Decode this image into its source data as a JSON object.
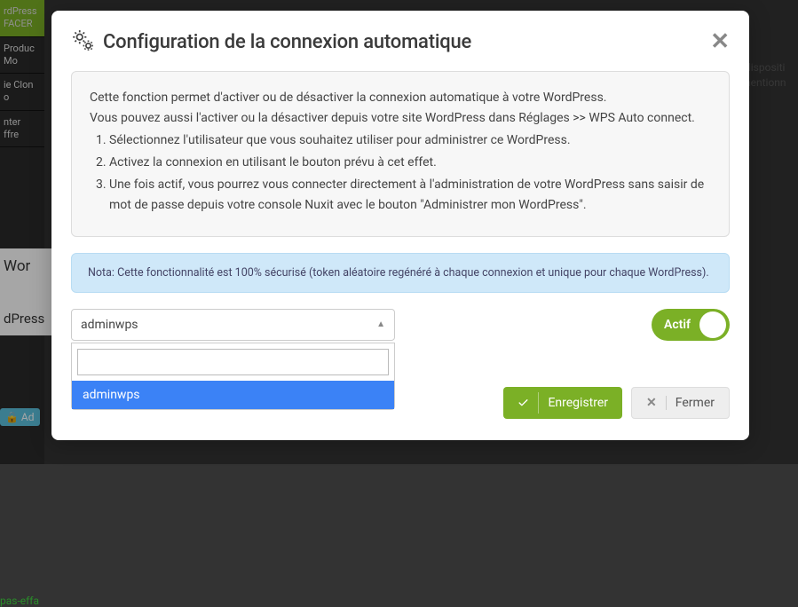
{
  "background": {
    "sidebar_items": [
      "rdPress",
      "FACER",
      "Produc",
      "Mo",
      "ie Clon",
      "o",
      "nter",
      "ffre"
    ],
    "content_head": "Wor",
    "content_sub": "dPress",
    "pas_effa": "pas-effa",
    "admin_btn": "Ad",
    "right_text1": "dispositi",
    "right_text2": "nentionn"
  },
  "dialog": {
    "title": "Configuration de la connexion automatique",
    "intro_line1": "Cette fonction permet d'activer ou de désactiver la connexion automatique à votre WordPress.",
    "intro_line2": "Vous pouvez aussi l'activer ou la désactiver depuis votre site WordPress dans Réglages >> WPS Auto connect.",
    "steps": [
      "Sélectionnez l'utilisateur que vous souhaitez utiliser pour administrer ce WordPress.",
      "Activez la connexion en utilisant le bouton prévu à cet effet.",
      "Une fois actif, vous pourrez vous connecter directement à l'administration de votre WordPress sans saisir de mot de passe depuis votre console Nuxit avec le bouton \"Administrer mon WordPress\"."
    ],
    "note": "Nota: Cette fonctionnalité est 100% sécurisé (token aléatoire regénéré à chaque connexion et unique pour chaque WordPress).",
    "combo": {
      "selected": "adminwps",
      "search_value": "",
      "options": [
        "adminwps"
      ]
    },
    "toggle": {
      "label": "Actif",
      "state": true
    },
    "save_label": "Enregistrer",
    "close_label": "Fermer"
  }
}
